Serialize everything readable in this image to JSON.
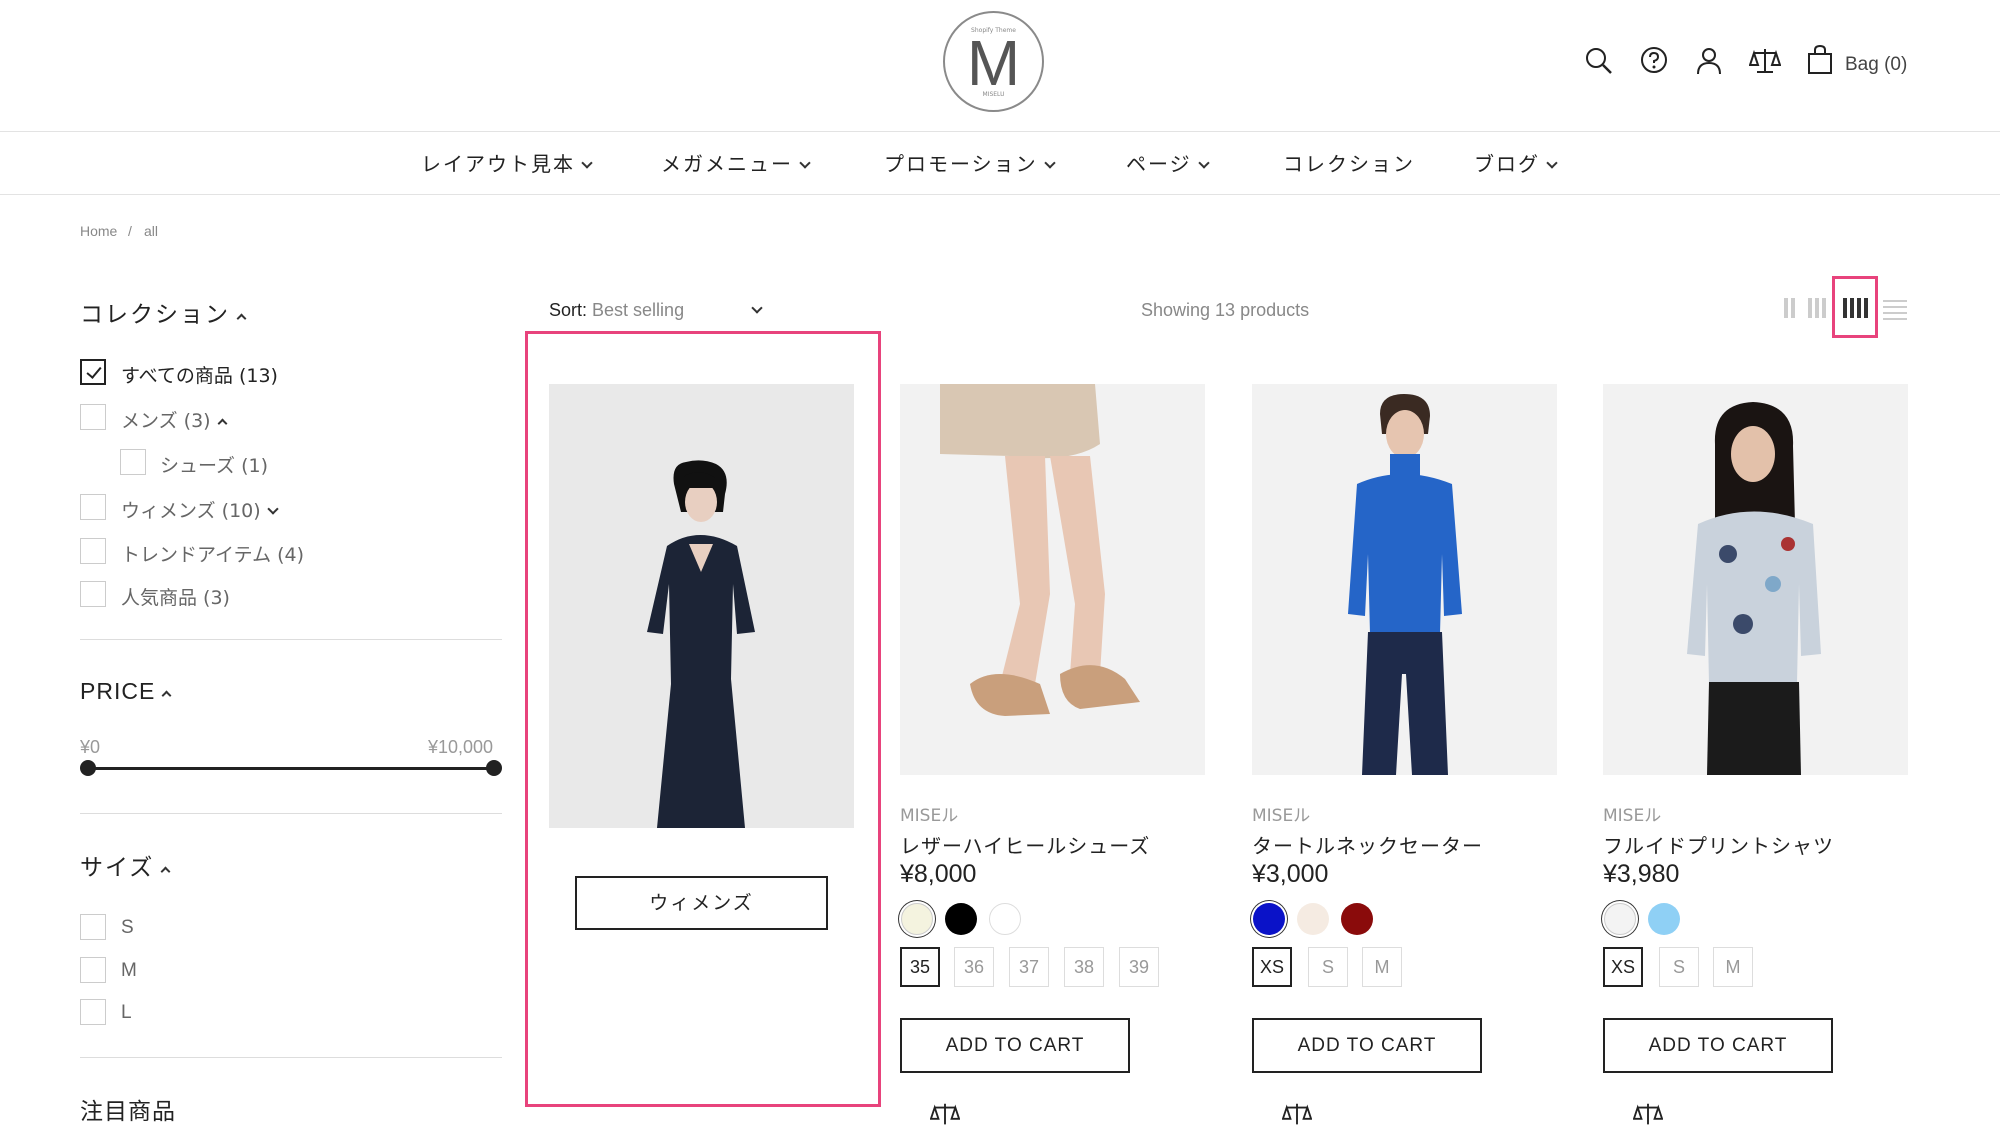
{
  "header": {
    "logo_top": "Shopify Theme",
    "logo_letter": "M",
    "logo_bottom": "MISELU",
    "bag_label": "Bag (0)",
    "icons": [
      "search-icon",
      "help-icon",
      "account-icon",
      "compare-icon",
      "bag-icon"
    ]
  },
  "nav": {
    "items": [
      {
        "label": "レイアウト見本",
        "dropdown": true
      },
      {
        "label": "メガメニュー",
        "dropdown": true
      },
      {
        "label": "プロモーション",
        "dropdown": true
      },
      {
        "label": "ページ",
        "dropdown": true
      },
      {
        "label": "コレクション",
        "dropdown": false
      },
      {
        "label": "ブログ",
        "dropdown": true
      }
    ]
  },
  "breadcrumb": {
    "home": "Home",
    "separator": "/",
    "current": "all"
  },
  "sidebar": {
    "collection": {
      "title": "コレクション",
      "items": [
        {
          "label": "すべての商品 (13)",
          "checked": true
        },
        {
          "label": "メンズ (3)",
          "checked": false
        },
        {
          "label": "シューズ (1)",
          "checked": false
        },
        {
          "label": "ウィメンズ (10)",
          "checked": false
        },
        {
          "label": "トレンドアイテム (4)",
          "checked": false
        },
        {
          "label": "人気商品 (3)",
          "checked": false
        }
      ]
    },
    "price": {
      "title": "PRICE",
      "min_label": "¥0",
      "max_label": "¥10,000",
      "selected_min": 0,
      "selected_max": 10000
    },
    "size": {
      "title": "サイズ",
      "options": [
        "S",
        "M",
        "L"
      ]
    },
    "featured_title": "注目商品"
  },
  "toolbar": {
    "sort_label": "Sort:",
    "sort_value": "Best selling",
    "showing": "Showing 13 products",
    "active_layout": "4-column"
  },
  "promo_card": {
    "button_label": "ウィメンズ"
  },
  "products": [
    {
      "vendor": "MISEル",
      "name": "レザーハイヒールシューズ",
      "price": "¥8,000",
      "swatches": [
        "#f4f3df",
        "#000000",
        "#ffffff"
      ],
      "selected_swatch": 0,
      "sizes": [
        "35",
        "36",
        "37",
        "38",
        "39"
      ],
      "selected_size": 0,
      "cart_label": "ADD TO CART"
    },
    {
      "vendor": "MISEル",
      "name": "タートルネックセーター",
      "price": "¥3,000",
      "swatches": [
        "#0a12c8",
        "#f5ebe2",
        "#8a0b0b"
      ],
      "selected_swatch": 0,
      "sizes": [
        "XS",
        "S",
        "M"
      ],
      "selected_size": 0,
      "cart_label": "ADD TO CART"
    },
    {
      "vendor": "MISEル",
      "name": "フルイドプリントシャツ",
      "price": "¥3,980",
      "swatches": [
        "#f3f3f3",
        "#8fd0f5"
      ],
      "selected_swatch": 0,
      "sizes": [
        "XS",
        "S",
        "M"
      ],
      "selected_size": 0,
      "cart_label": "ADD TO CART"
    }
  ],
  "colors": {
    "highlight": "#e8437c",
    "text": "#222222",
    "muted": "#888888"
  }
}
